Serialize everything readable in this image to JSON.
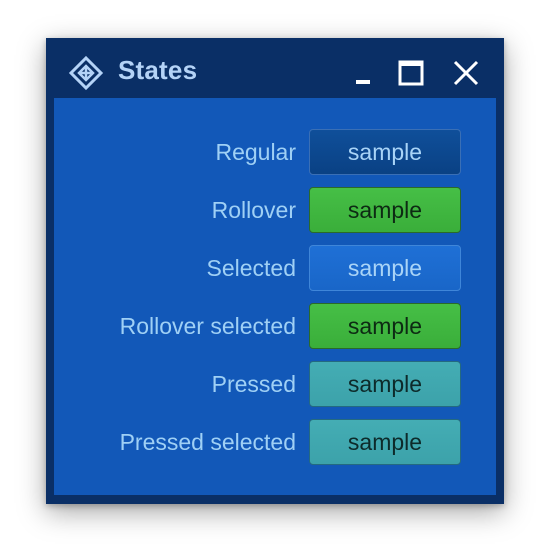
{
  "window": {
    "title": "States",
    "app_icon": "diamond-grid-icon",
    "controls": {
      "minimize": "minimize-icon",
      "maximize": "maximize-icon",
      "close": "close-icon"
    }
  },
  "rows": [
    {
      "label": "Regular",
      "button": "sample",
      "state": "regular",
      "bg": "#0a4184",
      "text_color": "#a9d4f7"
    },
    {
      "label": "Rollover",
      "button": "sample",
      "state": "rollover",
      "bg": "#3ab43a",
      "text_color": "#0d2a13"
    },
    {
      "label": "Selected",
      "button": "sample",
      "state": "selected",
      "bg": "#1966c8",
      "text_color": "#a9d4f7"
    },
    {
      "label": "Rollover selected",
      "button": "sample",
      "state": "rollover-selected",
      "bg": "#3ab43a",
      "text_color": "#0d2a13"
    },
    {
      "label": "Pressed",
      "button": "sample",
      "state": "pressed",
      "bg": "#3ca2aa",
      "text_color": "#0d2a2a"
    },
    {
      "label": "Pressed selected",
      "button": "sample",
      "state": "pressed-selected",
      "bg": "#3ca2aa",
      "text_color": "#0d2a2a"
    }
  ],
  "colors": {
    "frame": "#0a2f66",
    "content_bg": "#1258b8",
    "title_text": "#b4d3f7",
    "label_text": "#9fd0f5"
  }
}
